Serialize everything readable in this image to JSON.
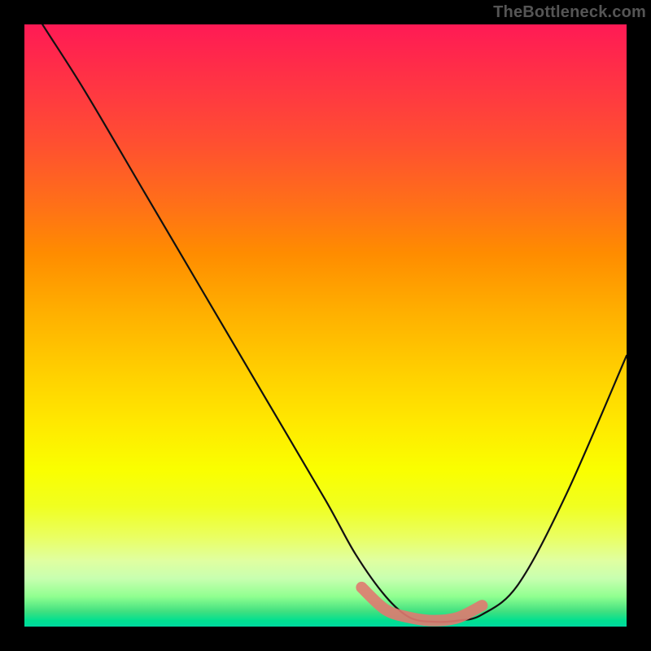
{
  "watermark": "TheBottleneck.com",
  "chart_data": {
    "type": "line",
    "title": "",
    "xlabel": "",
    "ylabel": "",
    "xlim": [
      0,
      1
    ],
    "ylim": [
      0,
      1
    ],
    "series": [
      {
        "name": "bottleneck-curve",
        "x": [
          0.0,
          0.03,
          0.1,
          0.2,
          0.3,
          0.4,
          0.5,
          0.55,
          0.6,
          0.64,
          0.68,
          0.72,
          0.76,
          0.82,
          0.9,
          1.0
        ],
        "values": [
          1.05,
          1.0,
          0.89,
          0.72,
          0.55,
          0.38,
          0.21,
          0.12,
          0.05,
          0.015,
          0.008,
          0.01,
          0.02,
          0.07,
          0.22,
          0.45
        ]
      },
      {
        "name": "highlight-band",
        "x": [
          0.56,
          0.6,
          0.64,
          0.68,
          0.72,
          0.76
        ],
        "values": [
          0.065,
          0.028,
          0.015,
          0.01,
          0.015,
          0.035
        ]
      }
    ],
    "colors": {
      "curve": "#111111",
      "highlight": "#e07a70",
      "gradient_top": "#ff1a55",
      "gradient_bottom": "#00d8a0"
    }
  }
}
